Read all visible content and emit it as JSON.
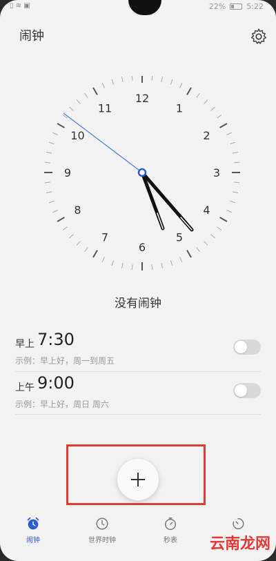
{
  "status": {
    "battery": "22%",
    "time": "5:22"
  },
  "header": {
    "title": "闹钟"
  },
  "clock": {
    "numbers": [
      "12",
      "1",
      "2",
      "3",
      "4",
      "5",
      "6",
      "7",
      "8",
      "9",
      "10",
      "11"
    ]
  },
  "empty_message": "没有闹钟",
  "alarms": [
    {
      "period": "早上",
      "time": "7:30",
      "subtitle": "示例：早上好，周一到周五",
      "enabled": false
    },
    {
      "period": "上午",
      "time": "9:00",
      "subtitle": "示例：早上好，周日 周六",
      "enabled": false
    }
  ],
  "tabs": [
    {
      "label": "闹钟",
      "icon": "alarm-clock-icon",
      "active": true
    },
    {
      "label": "世界时钟",
      "icon": "world-clock-icon",
      "active": false
    },
    {
      "label": "秒表",
      "icon": "stopwatch-icon",
      "active": false
    },
    {
      "label": "",
      "icon": "timer-icon",
      "active": false
    }
  ],
  "watermark": "云南龙网",
  "colors": {
    "accent": "#2a5bd7",
    "highlight": "#e53935",
    "background": "#f3f3f3"
  }
}
